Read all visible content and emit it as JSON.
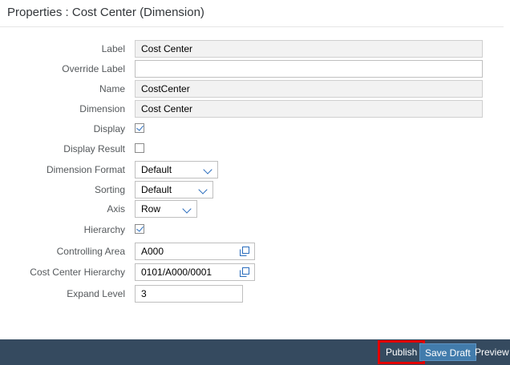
{
  "header": {
    "title": "Properties : Cost Center (Dimension)"
  },
  "form": {
    "label": {
      "label": "Label",
      "value": "Cost Center"
    },
    "override_label": {
      "label": "Override Label",
      "value": ""
    },
    "name": {
      "label": "Name",
      "value": "CostCenter"
    },
    "dimension": {
      "label": "Dimension",
      "value": "Cost Center"
    },
    "display": {
      "label": "Display",
      "checked": true
    },
    "display_result": {
      "label": "Display Result",
      "checked": false
    },
    "dimension_format": {
      "label": "Dimension Format",
      "value": "Default"
    },
    "sorting": {
      "label": "Sorting",
      "value": "Default"
    },
    "axis": {
      "label": "Axis",
      "value": "Row"
    },
    "hierarchy": {
      "label": "Hierarchy",
      "checked": true
    },
    "controlling_area": {
      "label": "Controlling Area",
      "value": "A000"
    },
    "cost_center_hierarchy": {
      "label": "Cost Center Hierarchy",
      "value": "0101/A000/0001"
    },
    "expand_level": {
      "label": "Expand Level",
      "value": "3"
    }
  },
  "footer": {
    "publish_label": "Publish",
    "save_draft_label": "Save Draft",
    "preview_label": "Preview"
  },
  "colors": {
    "footer_bg": "#354a5f",
    "accent": "#2a6dbd",
    "highlight": "#e30000",
    "save_button": "#427cac"
  }
}
